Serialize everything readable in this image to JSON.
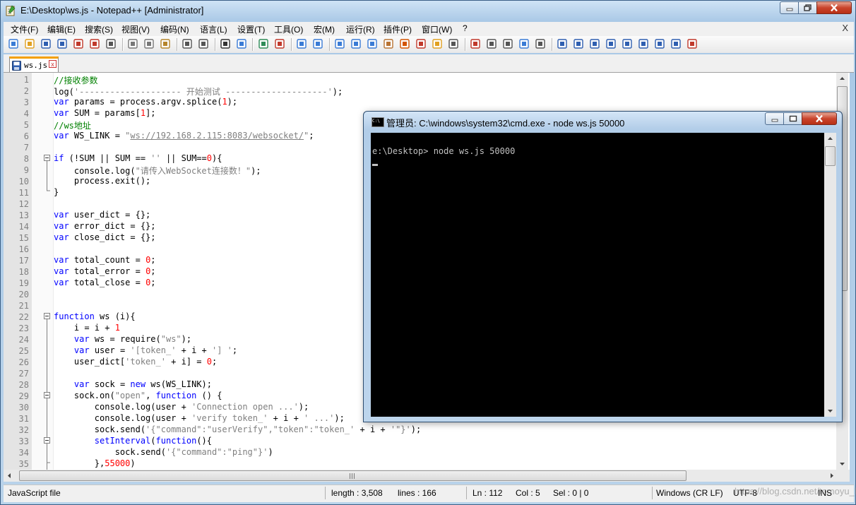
{
  "notepad": {
    "title": "E:\\Desktop\\ws.js - Notepad++ [Administrator]",
    "menu": [
      "文件(F)",
      "编辑(E)",
      "搜索(S)",
      "视图(V)",
      "编码(N)",
      "语言(L)",
      "设置(T)",
      "工具(O)",
      "宏(M)",
      "运行(R)",
      "插件(P)",
      "窗口(W)",
      "?"
    ],
    "menu_close": "X",
    "tab_label": "ws.js",
    "tab_close": "x",
    "toolbar_icons": [
      "new-file-icon",
      "open-file-icon",
      "save-icon",
      "save-all-icon",
      "close-icon",
      "close-all-icon",
      "print-icon",
      "cut-icon",
      "copy-icon",
      "paste-icon",
      "undo-icon",
      "redo-icon",
      "find-icon",
      "replace-icon",
      "zoom-in-icon",
      "zoom-out-icon",
      "sync-vertical-icon",
      "sync-horizontal-icon",
      "word-wrap-icon",
      "show-all-chars-icon",
      "indent-guide-icon",
      "user-language-icon",
      "document-map-icon",
      "function-list-icon",
      "folder-workspace-icon",
      "monitoring-icon",
      "record-macro-icon",
      "stop-record-icon",
      "play-macro-icon",
      "run-macro-multiple-icon",
      "save-macro-icon",
      "plugin-1-icon",
      "plugin-2-icon",
      "plugin-3-icon",
      "plugin-4-icon",
      "arrow-up-icon",
      "arrow-down-icon",
      "plugin-5-icon",
      "plugin-6-icon",
      "spell-check-icon"
    ],
    "code_lines": [
      {
        "n": "1",
        "t": [
          {
            "c": "cm",
            "v": "//接收参数"
          }
        ]
      },
      {
        "n": "2",
        "t": [
          {
            "c": "",
            "v": "log("
          },
          {
            "c": "st",
            "v": "'-------------------- 开始测试 --------------------'"
          },
          {
            "c": "",
            "v": ");"
          }
        ]
      },
      {
        "n": "3",
        "t": [
          {
            "c": "kw",
            "v": "var"
          },
          {
            "c": "",
            "v": " params = process.argv.splice("
          },
          {
            "c": "nm",
            "v": "1"
          },
          {
            "c": "",
            "v": ");"
          }
        ]
      },
      {
        "n": "4",
        "t": [
          {
            "c": "kw",
            "v": "var"
          },
          {
            "c": "",
            "v": " SUM = params["
          },
          {
            "c": "nm",
            "v": "1"
          },
          {
            "c": "",
            "v": "];"
          }
        ]
      },
      {
        "n": "5",
        "t": [
          {
            "c": "cm",
            "v": "//ws地址"
          }
        ]
      },
      {
        "n": "6",
        "t": [
          {
            "c": "kw",
            "v": "var"
          },
          {
            "c": "",
            "v": " WS_LINK = "
          },
          {
            "c": "st",
            "v": "\""
          },
          {
            "c": "st ul",
            "v": "ws://192.168.2.115:8083/websocket/"
          },
          {
            "c": "st",
            "v": "\""
          },
          {
            "c": "",
            "v": ";"
          }
        ]
      },
      {
        "n": "7",
        "t": []
      },
      {
        "n": "8",
        "t": [
          {
            "c": "kw",
            "v": "if"
          },
          {
            "c": "",
            "v": " (!SUM || SUM == "
          },
          {
            "c": "st",
            "v": "''"
          },
          {
            "c": "",
            "v": " || SUM=="
          },
          {
            "c": "nm",
            "v": "0"
          },
          {
            "c": "",
            "v": "){"
          }
        ]
      },
      {
        "n": "9",
        "t": [
          {
            "c": "",
            "v": "    console.log("
          },
          {
            "c": "st",
            "v": "\"请传入WebSocket连接数！\""
          },
          {
            "c": "",
            "v": ");"
          }
        ]
      },
      {
        "n": "10",
        "t": [
          {
            "c": "",
            "v": "    process.exit();"
          }
        ]
      },
      {
        "n": "11",
        "t": [
          {
            "c": "",
            "v": "}"
          }
        ]
      },
      {
        "n": "12",
        "t": []
      },
      {
        "n": "13",
        "t": [
          {
            "c": "kw",
            "v": "var"
          },
          {
            "c": "",
            "v": " user_dict = {};"
          }
        ]
      },
      {
        "n": "14",
        "t": [
          {
            "c": "kw",
            "v": "var"
          },
          {
            "c": "",
            "v": " error_dict = {};"
          }
        ]
      },
      {
        "n": "15",
        "t": [
          {
            "c": "kw",
            "v": "var"
          },
          {
            "c": "",
            "v": " close_dict = {};"
          }
        ]
      },
      {
        "n": "16",
        "t": []
      },
      {
        "n": "17",
        "t": [
          {
            "c": "kw",
            "v": "var"
          },
          {
            "c": "",
            "v": " total_count = "
          },
          {
            "c": "nm",
            "v": "0"
          },
          {
            "c": "",
            "v": ";"
          }
        ]
      },
      {
        "n": "18",
        "t": [
          {
            "c": "kw",
            "v": "var"
          },
          {
            "c": "",
            "v": " total_error = "
          },
          {
            "c": "nm",
            "v": "0"
          },
          {
            "c": "",
            "v": ";"
          }
        ]
      },
      {
        "n": "19",
        "t": [
          {
            "c": "kw",
            "v": "var"
          },
          {
            "c": "",
            "v": " total_close = "
          },
          {
            "c": "nm",
            "v": "0"
          },
          {
            "c": "",
            "v": ";"
          }
        ]
      },
      {
        "n": "20",
        "t": []
      },
      {
        "n": "21",
        "t": []
      },
      {
        "n": "22",
        "t": [
          {
            "c": "kw",
            "v": "function"
          },
          {
            "c": "",
            "v": " ws (i){"
          }
        ]
      },
      {
        "n": "23",
        "t": [
          {
            "c": "",
            "v": "    i = i + "
          },
          {
            "c": "nm",
            "v": "1"
          }
        ]
      },
      {
        "n": "24",
        "t": [
          {
            "c": "",
            "v": "    "
          },
          {
            "c": "kw",
            "v": "var"
          },
          {
            "c": "",
            "v": " ws = require("
          },
          {
            "c": "st",
            "v": "\"ws\""
          },
          {
            "c": "",
            "v": ");"
          }
        ]
      },
      {
        "n": "25",
        "t": [
          {
            "c": "",
            "v": "    "
          },
          {
            "c": "kw",
            "v": "var"
          },
          {
            "c": "",
            "v": " user = "
          },
          {
            "c": "st",
            "v": "'[token_'"
          },
          {
            "c": "",
            "v": " + i + "
          },
          {
            "c": "st",
            "v": "'] '"
          },
          {
            "c": "",
            "v": ";"
          }
        ]
      },
      {
        "n": "26",
        "t": [
          {
            "c": "",
            "v": "    user_dict["
          },
          {
            "c": "st",
            "v": "'token_'"
          },
          {
            "c": "",
            "v": " + i] = "
          },
          {
            "c": "nm",
            "v": "0"
          },
          {
            "c": "",
            "v": ";"
          }
        ]
      },
      {
        "n": "27",
        "t": []
      },
      {
        "n": "28",
        "t": [
          {
            "c": "",
            "v": "    "
          },
          {
            "c": "kw",
            "v": "var"
          },
          {
            "c": "",
            "v": " sock = "
          },
          {
            "c": "kw",
            "v": "new"
          },
          {
            "c": "",
            "v": " ws(WS_LINK);"
          }
        ]
      },
      {
        "n": "29",
        "t": [
          {
            "c": "",
            "v": "    sock.on("
          },
          {
            "c": "st",
            "v": "\"open\""
          },
          {
            "c": "",
            "v": ", "
          },
          {
            "c": "kw",
            "v": "function"
          },
          {
            "c": "",
            "v": " () {"
          }
        ]
      },
      {
        "n": "30",
        "t": [
          {
            "c": "",
            "v": "        console.log(user + "
          },
          {
            "c": "st",
            "v": "'Connection open ...'"
          },
          {
            "c": "",
            "v": ");"
          }
        ]
      },
      {
        "n": "31",
        "t": [
          {
            "c": "",
            "v": "        console.log(user + "
          },
          {
            "c": "st",
            "v": "'verify token_'"
          },
          {
            "c": "",
            "v": " + i + "
          },
          {
            "c": "st",
            "v": "' ...'"
          },
          {
            "c": "",
            "v": ");"
          }
        ]
      },
      {
        "n": "32",
        "t": [
          {
            "c": "",
            "v": "        sock.send("
          },
          {
            "c": "st",
            "v": "'{\"command\":\"userVerify\",\"token\":\"token_'"
          },
          {
            "c": "",
            "v": " + i + "
          },
          {
            "c": "st",
            "v": "'\"}'"
          },
          {
            "c": "",
            "v": ");"
          }
        ]
      },
      {
        "n": "33",
        "t": [
          {
            "c": "",
            "v": "        "
          },
          {
            "c": "kw",
            "v": "setInterval"
          },
          {
            "c": "",
            "v": "("
          },
          {
            "c": "kw",
            "v": "function"
          },
          {
            "c": "",
            "v": "(){"
          }
        ]
      },
      {
        "n": "34",
        "t": [
          {
            "c": "",
            "v": "            sock.send("
          },
          {
            "c": "st",
            "v": "'{\"command\":\"ping\"}'"
          },
          {
            "c": "",
            "v": ")"
          }
        ]
      },
      {
        "n": "35",
        "t": [
          {
            "c": "",
            "v": "        },"
          },
          {
            "c": "nm",
            "v": "55000"
          },
          {
            "c": "",
            "v": ")"
          }
        ]
      }
    ],
    "status": {
      "file_type": "JavaScript file",
      "length": "length : 3,508",
      "lines": "lines : 166",
      "ln": "Ln : 112",
      "col": "Col : 5",
      "sel": "Sel : 0 | 0",
      "eol": "Windows (CR LF)",
      "encoding": "UTF-8",
      "ins": "INS"
    }
  },
  "cmd": {
    "title": "管理员: C:\\windows\\system32\\cmd.exe - node  ws.js 50000",
    "prompt_line": "e:\\Desktop> node ws.js 50000"
  },
  "watermark": "https://blog.csdn.net/tomoyu_leg"
}
